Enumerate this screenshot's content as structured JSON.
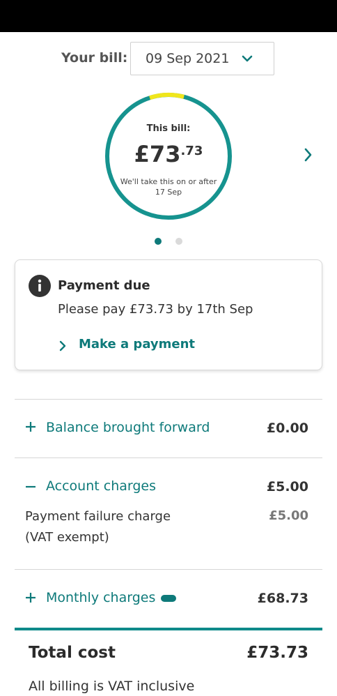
{
  "bill_selector": {
    "label": "Your bill:",
    "selected": "09 Sep 2021"
  },
  "summary": {
    "title": "This bill:",
    "currency": "£",
    "amount_main": "73",
    "amount_pence": ".73",
    "note": "We'll take this on or after 17 Sep",
    "paid_fraction_yellow": 0.09
  },
  "carousel": {
    "page": 1,
    "total_pages": 2
  },
  "payment_card": {
    "title": "Payment due",
    "message": "Please pay £73.73 by 17th Sep",
    "link": "Make a payment"
  },
  "breakdown": {
    "balance": {
      "label": "Balance brought forward",
      "value": "£0.00"
    },
    "account": {
      "label": "Account charges",
      "value": "£5.00",
      "items": [
        {
          "label_line1": "Payment failure charge",
          "label_line2": "(VAT exempt)",
          "value": "£5.00"
        }
      ]
    },
    "monthly": {
      "label": "Monthly charges",
      "value": "£68.73"
    }
  },
  "total": {
    "label": "Total cost",
    "value": "£73.73",
    "note": "All billing is VAT inclusive"
  },
  "colors": {
    "teal": "#0e7a7a",
    "ring_teal": "#16938f",
    "ring_yellow": "#f0e61c"
  }
}
